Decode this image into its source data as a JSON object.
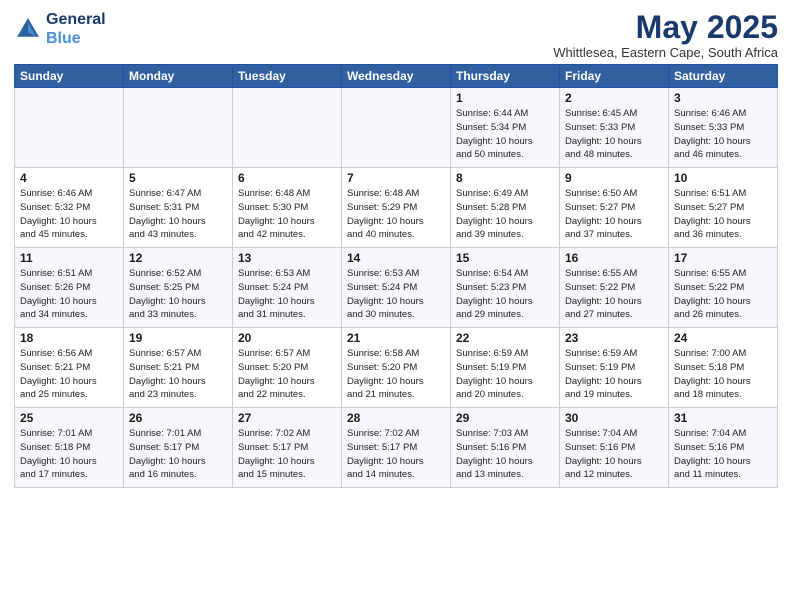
{
  "header": {
    "logo_line1": "General",
    "logo_line2": "Blue",
    "title": "May 2025",
    "subtitle": "Whittlesea, Eastern Cape, South Africa"
  },
  "days_of_week": [
    "Sunday",
    "Monday",
    "Tuesday",
    "Wednesday",
    "Thursday",
    "Friday",
    "Saturday"
  ],
  "weeks": [
    [
      {
        "num": "",
        "info": ""
      },
      {
        "num": "",
        "info": ""
      },
      {
        "num": "",
        "info": ""
      },
      {
        "num": "",
        "info": ""
      },
      {
        "num": "1",
        "info": "Sunrise: 6:44 AM\nSunset: 5:34 PM\nDaylight: 10 hours\nand 50 minutes."
      },
      {
        "num": "2",
        "info": "Sunrise: 6:45 AM\nSunset: 5:33 PM\nDaylight: 10 hours\nand 48 minutes."
      },
      {
        "num": "3",
        "info": "Sunrise: 6:46 AM\nSunset: 5:33 PM\nDaylight: 10 hours\nand 46 minutes."
      }
    ],
    [
      {
        "num": "4",
        "info": "Sunrise: 6:46 AM\nSunset: 5:32 PM\nDaylight: 10 hours\nand 45 minutes."
      },
      {
        "num": "5",
        "info": "Sunrise: 6:47 AM\nSunset: 5:31 PM\nDaylight: 10 hours\nand 43 minutes."
      },
      {
        "num": "6",
        "info": "Sunrise: 6:48 AM\nSunset: 5:30 PM\nDaylight: 10 hours\nand 42 minutes."
      },
      {
        "num": "7",
        "info": "Sunrise: 6:48 AM\nSunset: 5:29 PM\nDaylight: 10 hours\nand 40 minutes."
      },
      {
        "num": "8",
        "info": "Sunrise: 6:49 AM\nSunset: 5:28 PM\nDaylight: 10 hours\nand 39 minutes."
      },
      {
        "num": "9",
        "info": "Sunrise: 6:50 AM\nSunset: 5:27 PM\nDaylight: 10 hours\nand 37 minutes."
      },
      {
        "num": "10",
        "info": "Sunrise: 6:51 AM\nSunset: 5:27 PM\nDaylight: 10 hours\nand 36 minutes."
      }
    ],
    [
      {
        "num": "11",
        "info": "Sunrise: 6:51 AM\nSunset: 5:26 PM\nDaylight: 10 hours\nand 34 minutes."
      },
      {
        "num": "12",
        "info": "Sunrise: 6:52 AM\nSunset: 5:25 PM\nDaylight: 10 hours\nand 33 minutes."
      },
      {
        "num": "13",
        "info": "Sunrise: 6:53 AM\nSunset: 5:24 PM\nDaylight: 10 hours\nand 31 minutes."
      },
      {
        "num": "14",
        "info": "Sunrise: 6:53 AM\nSunset: 5:24 PM\nDaylight: 10 hours\nand 30 minutes."
      },
      {
        "num": "15",
        "info": "Sunrise: 6:54 AM\nSunset: 5:23 PM\nDaylight: 10 hours\nand 29 minutes."
      },
      {
        "num": "16",
        "info": "Sunrise: 6:55 AM\nSunset: 5:22 PM\nDaylight: 10 hours\nand 27 minutes."
      },
      {
        "num": "17",
        "info": "Sunrise: 6:55 AM\nSunset: 5:22 PM\nDaylight: 10 hours\nand 26 minutes."
      }
    ],
    [
      {
        "num": "18",
        "info": "Sunrise: 6:56 AM\nSunset: 5:21 PM\nDaylight: 10 hours\nand 25 minutes."
      },
      {
        "num": "19",
        "info": "Sunrise: 6:57 AM\nSunset: 5:21 PM\nDaylight: 10 hours\nand 23 minutes."
      },
      {
        "num": "20",
        "info": "Sunrise: 6:57 AM\nSunset: 5:20 PM\nDaylight: 10 hours\nand 22 minutes."
      },
      {
        "num": "21",
        "info": "Sunrise: 6:58 AM\nSunset: 5:20 PM\nDaylight: 10 hours\nand 21 minutes."
      },
      {
        "num": "22",
        "info": "Sunrise: 6:59 AM\nSunset: 5:19 PM\nDaylight: 10 hours\nand 20 minutes."
      },
      {
        "num": "23",
        "info": "Sunrise: 6:59 AM\nSunset: 5:19 PM\nDaylight: 10 hours\nand 19 minutes."
      },
      {
        "num": "24",
        "info": "Sunrise: 7:00 AM\nSunset: 5:18 PM\nDaylight: 10 hours\nand 18 minutes."
      }
    ],
    [
      {
        "num": "25",
        "info": "Sunrise: 7:01 AM\nSunset: 5:18 PM\nDaylight: 10 hours\nand 17 minutes."
      },
      {
        "num": "26",
        "info": "Sunrise: 7:01 AM\nSunset: 5:17 PM\nDaylight: 10 hours\nand 16 minutes."
      },
      {
        "num": "27",
        "info": "Sunrise: 7:02 AM\nSunset: 5:17 PM\nDaylight: 10 hours\nand 15 minutes."
      },
      {
        "num": "28",
        "info": "Sunrise: 7:02 AM\nSunset: 5:17 PM\nDaylight: 10 hours\nand 14 minutes."
      },
      {
        "num": "29",
        "info": "Sunrise: 7:03 AM\nSunset: 5:16 PM\nDaylight: 10 hours\nand 13 minutes."
      },
      {
        "num": "30",
        "info": "Sunrise: 7:04 AM\nSunset: 5:16 PM\nDaylight: 10 hours\nand 12 minutes."
      },
      {
        "num": "31",
        "info": "Sunrise: 7:04 AM\nSunset: 5:16 PM\nDaylight: 10 hours\nand 11 minutes."
      }
    ]
  ]
}
